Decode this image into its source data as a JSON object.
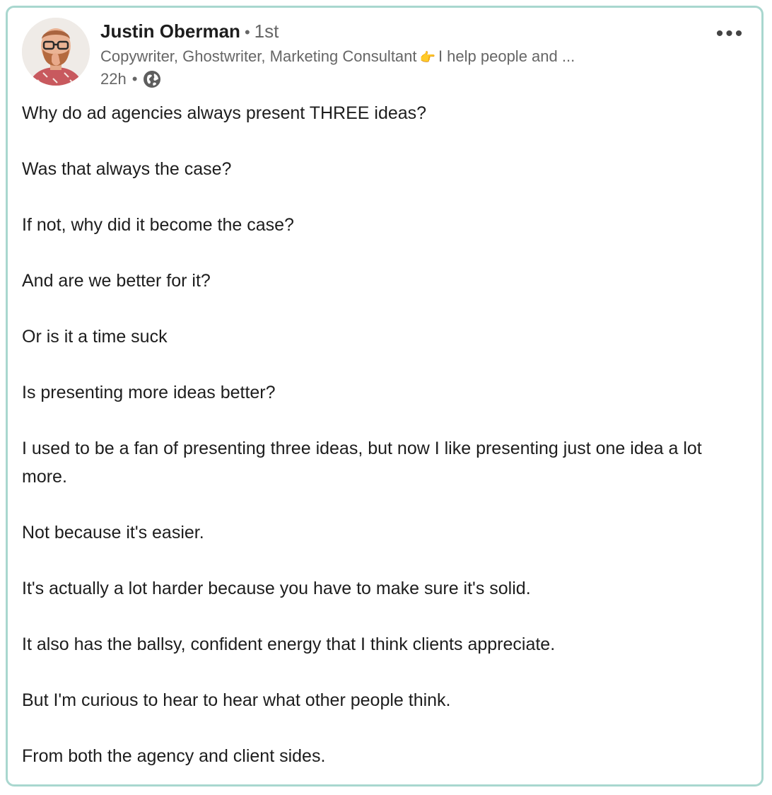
{
  "author": {
    "name": "Justin Oberman",
    "separator": "•",
    "degree": "1st",
    "headline_text": "Copywriter, Ghostwriter, Marketing Consultant",
    "headline_emoji": "👉",
    "headline_tail": "I help people and ...",
    "time": "22h",
    "time_separator": "•",
    "visibility_icon": "globe-icon"
  },
  "menu": {
    "more_label": "•••"
  },
  "post": {
    "paragraphs": [
      "Why do ad agencies always present THREE ideas?",
      "Was that always the case?",
      "If not, why did it become the case?",
      "And are we better for it?",
      "Or is it a time suck",
      "Is presenting more ideas better?",
      "I used to be a fan of presenting three ideas, but now I like presenting just one idea a lot more.",
      "Not because it's easier.",
      "It's actually a lot harder because you have to make sure it's solid.",
      "It also has the ballsy, confident energy that I think clients appreciate.",
      "But I'm curious to hear to hear what other people think.",
      "From both the agency and client sides."
    ]
  },
  "colors": {
    "frame_border": "#a9d7cf",
    "text_primary": "#1d1d1d",
    "text_secondary": "#666666"
  }
}
